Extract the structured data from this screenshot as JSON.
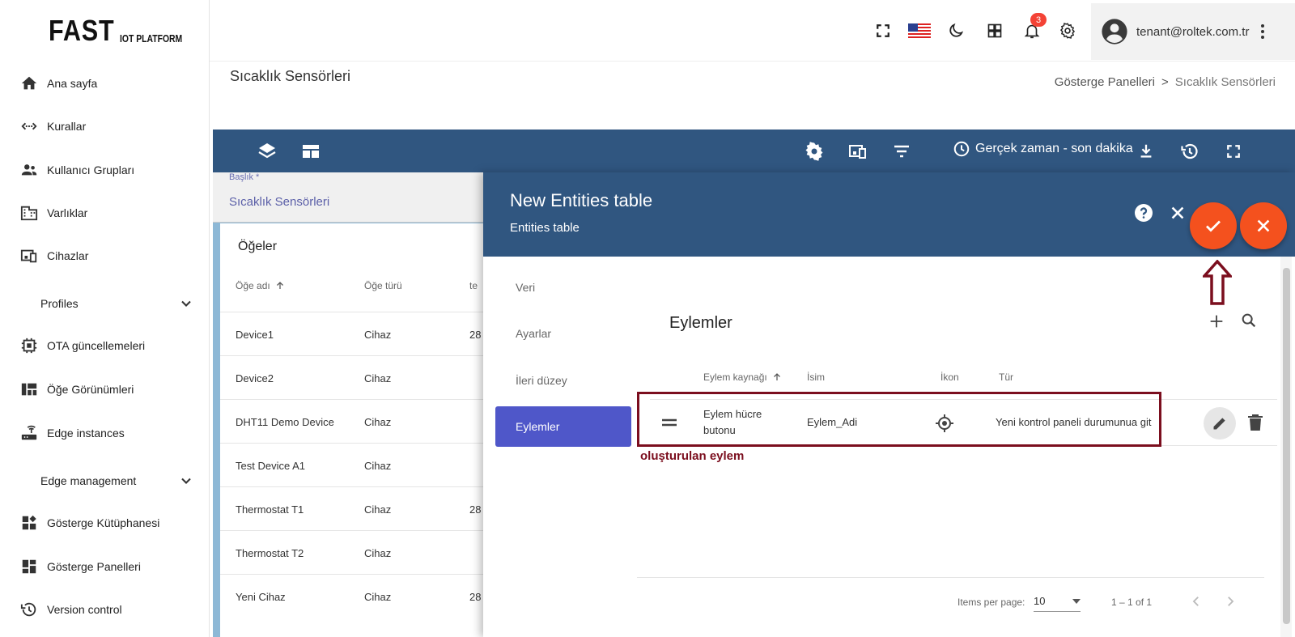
{
  "logo": {
    "big": "FAST",
    "small": "IOT PLATFORM"
  },
  "sidebar": {
    "items": [
      {
        "label": "Ana sayfa"
      },
      {
        "label": "Kurallar"
      },
      {
        "label": "Kullanıcı Grupları"
      },
      {
        "label": "Varlıklar"
      },
      {
        "label": "Cihazlar"
      },
      {
        "label": "Profiles"
      },
      {
        "label": "OTA güncellemeleri"
      },
      {
        "label": "Öğe Görünümleri"
      },
      {
        "label": "Edge instances"
      },
      {
        "label": "Edge management"
      },
      {
        "label": "Gösterge Kütüphanesi"
      },
      {
        "label": "Gösterge Panelleri"
      },
      {
        "label": "Version control"
      }
    ]
  },
  "topbar": {
    "notification_count": "3",
    "user_email": "tenant@roltek.com.tr"
  },
  "page": {
    "title": "Sıcaklık Sensörleri",
    "breadcrumb": [
      "Gösterge Panelleri",
      ">",
      "Sıcaklık Sensörleri"
    ]
  },
  "dashbar": {
    "realtime_label": "Gerçek zaman - son dakika"
  },
  "title_field": {
    "label": "Başlık *",
    "value": "Sıcaklık Sensörleri"
  },
  "widget": {
    "title": "Öğeler",
    "headers": [
      "Öğe adı",
      "Öğe türü",
      "te"
    ],
    "rows": [
      {
        "name": "Device1",
        "type": "Cihaz",
        "extra": "28"
      },
      {
        "name": "Device2",
        "type": "Cihaz",
        "extra": ""
      },
      {
        "name": "DHT11 Demo Device",
        "type": "Cihaz",
        "extra": ""
      },
      {
        "name": "Test Device A1",
        "type": "Cihaz",
        "extra": ""
      },
      {
        "name": "Thermostat T1",
        "type": "Cihaz",
        "extra": "28"
      },
      {
        "name": "Thermostat T2",
        "type": "Cihaz",
        "extra": ""
      },
      {
        "name": "Yeni Cihaz",
        "type": "Cihaz",
        "extra": "28"
      }
    ]
  },
  "dialog": {
    "title": "New Entities table",
    "subtitle": "Entities table",
    "tabs": [
      "Veri",
      "Ayarlar",
      "İleri düzey",
      "Eylemler"
    ],
    "section_title": "Eylemler",
    "headers": [
      "Eylem kaynağı",
      "İsim",
      "İkon",
      "Tür"
    ],
    "row": {
      "source_line1": "Eylem hücre",
      "source_line2": "butonu",
      "name": "Eylem_Adi",
      "type": "Yeni kontrol paneli durumunua git"
    },
    "annotation": "oluşturulan eylem",
    "paginator": {
      "items_per_page_label": "Items per page:",
      "page_size": "10",
      "range": "1 – 1 of 1"
    }
  },
  "colors": {
    "primary": "#305680",
    "accent": "#f4511e",
    "active_tab": "#4f57c9",
    "annotation": "#7b0e1e"
  }
}
